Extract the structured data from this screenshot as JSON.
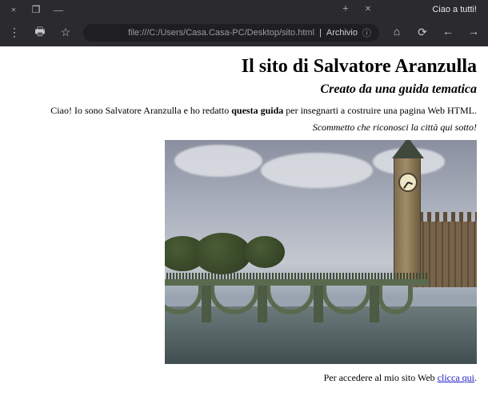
{
  "window": {
    "title": "Ciao a tutti!",
    "close_glyph": "×",
    "restore_glyph": "❐",
    "minimize_glyph": "—"
  },
  "tabs": {
    "new_glyph": "+",
    "close_glyph": "×"
  },
  "nav": {
    "menu_glyph": "⋮",
    "print_glyph": "🖶",
    "star_glyph": "☆",
    "back_glyph": "←",
    "forward_glyph": "→",
    "reload_glyph": "⟳",
    "home_glyph": "⌂",
    "secure_glyph": "ⓘ"
  },
  "url": {
    "prefix": "Archivio",
    "path": "file:///C:/Users/Casa.Casa-PC/Desktop/sito.html"
  },
  "page": {
    "h1": "Il sito di Salvatore Aranzulla",
    "h2": "Creato da una guida tematica",
    "intro_pre": "Ciao! Io sono Salvatore Aranzulla e ho redatto ",
    "intro_bold": "questa guida",
    "intro_post": " per insegnarti a costruire una pagina Web HTML.",
    "italic_line": "Scommetto che riconosci la città qui sotto!",
    "footer_pre": "Per accedere al mio sito Web ",
    "footer_link": "clicca qui",
    "footer_post": "."
  }
}
